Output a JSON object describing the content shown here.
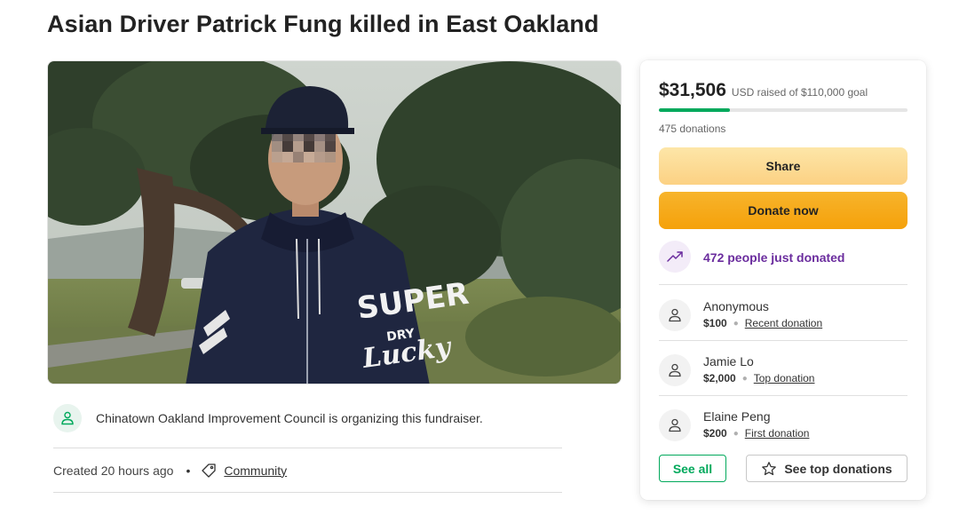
{
  "page": {
    "title": "Asian Driver Patrick Fung killed in East Oakland"
  },
  "hero": {
    "image_alt": "Photo of person in hooded sweatshirt with trees behind",
    "hoodie_text": [
      "SUPER",
      "DRY",
      "Lucky"
    ]
  },
  "organizer": {
    "text": "Chinatown Oakland Improvement Council is organizing this fundraiser.",
    "icon": "person-heart-icon"
  },
  "meta": {
    "created": "Created 20 hours ago",
    "separator": "•",
    "category": "Community",
    "icon": "tag-icon"
  },
  "donation_panel": {
    "raised": "$31,506",
    "goal_text": "USD raised of $110,000 goal",
    "progress_fraction": 0.286,
    "donations_count": "475 donations",
    "share_label": "Share",
    "donate_label": "Donate now",
    "trend_text": "472 people just donated",
    "donors": [
      {
        "name": "Anonymous",
        "amount": "$100",
        "kind": "Recent donation"
      },
      {
        "name": "Jamie Lo",
        "amount": "$2,000",
        "kind": "Top donation"
      },
      {
        "name": "Elaine Peng",
        "amount": "$200",
        "kind": "First donation"
      }
    ],
    "see_all_label": "See all",
    "see_top_label": "See top donations"
  },
  "colors": {
    "accent_green": "#02a95c",
    "share_yellow": "#fcd183",
    "donate_orange": "#f5a10a",
    "trend_purple": "#6b2d9e"
  }
}
